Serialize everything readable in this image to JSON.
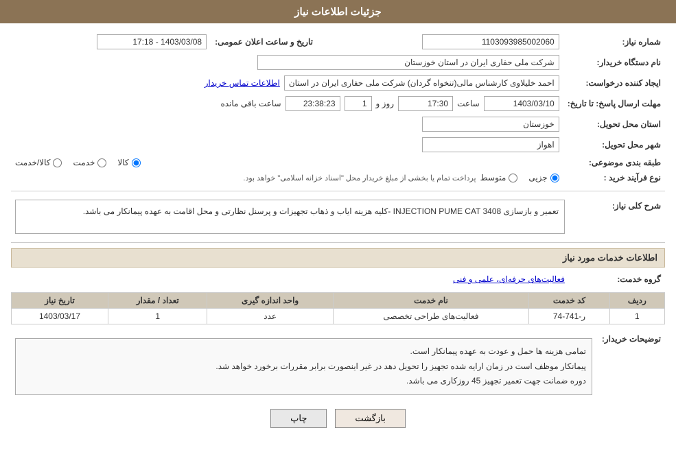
{
  "header": {
    "title": "جزئیات اطلاعات نیاز"
  },
  "fields": {
    "need_number_label": "شماره نیاز:",
    "need_number_value": "1103093985002060",
    "public_announce_label": "تاریخ و ساعت اعلان عمومی:",
    "public_announce_value": "1403/03/08 - 17:18",
    "buyer_name_label": "نام دستگاه خریدار:",
    "buyer_name_value": "شرکت ملی حفاری ایران در استان خوزستان",
    "creator_label": "ایجاد کننده درخواست:",
    "creator_value": "احمد خلیلاوی کارشناس مالی(تنخواه گردان) شرکت ملی حفاری ایران در استان",
    "creator_link": "اطلاعات تماس خریدار",
    "reply_deadline_label": "مهلت ارسال پاسخ: تا تاریخ:",
    "reply_date_value": "1403/03/10",
    "reply_time_label": "ساعت",
    "reply_time_value": "17:30",
    "reply_days_label": "روز و",
    "reply_days_value": "1",
    "reply_remaining_label": "ساعت باقی مانده",
    "reply_remaining_value": "23:38:23",
    "province_label": "استان محل تحویل:",
    "province_value": "خوزستان",
    "city_label": "شهر محل تحویل:",
    "city_value": "اهواز",
    "category_label": "طبقه بندی موضوعی:",
    "category_options": [
      "کالا",
      "خدمت",
      "کالا/خدمت"
    ],
    "category_selected": "کالا",
    "purchase_type_label": "نوع فرآیند خرید :",
    "purchase_options": [
      "جزیی",
      "متوسط"
    ],
    "purchase_note": "پرداخت تمام یا بخشی از مبلغ خریدار محل \"اسناد خزانه اسلامی\" خواهد بود.",
    "description_label": "شرح کلی نیاز:",
    "description_value": "تعمیر و بازسازی INJECTION PUME CAT 3408 -کلیه هزینه ایاب و ذهاب تجهیزات و پرسنل نظارتی و محل اقامت به عهده پیمانکار می باشد.",
    "services_section_label": "اطلاعات خدمات مورد نیاز",
    "service_group_label": "گروه خدمت:",
    "service_group_value": "فعالیت‌های حرفه‌ای، علمی و فنی",
    "table_headers": [
      "ردیف",
      "کد خدمت",
      "نام خدمت",
      "واحد اندازه گیری",
      "تعداد / مقدار",
      "تاریخ نیاز"
    ],
    "table_rows": [
      {
        "row": "1",
        "code": "ر-741-74",
        "name": "فعالیت‌های طراحی تخصصی",
        "unit": "عدد",
        "quantity": "1",
        "date": "1403/03/17"
      }
    ],
    "buyer_notes_label": "توضیحات خریدار:",
    "buyer_notes_value": "تمامی هزینه ها حمل و عودت به عهده پیمانکار است.\nپیمانکار موظف است در زمان ارایه شده تجهیز را تحویل دهد در غیر اینصورت برابر مقررات برخورد خواهد شد.\nدوره ضمانت جهت تعمیر تجهیز 45 روزکاری می باشد.",
    "btn_back": "بازگشت",
    "btn_print": "چاپ"
  }
}
